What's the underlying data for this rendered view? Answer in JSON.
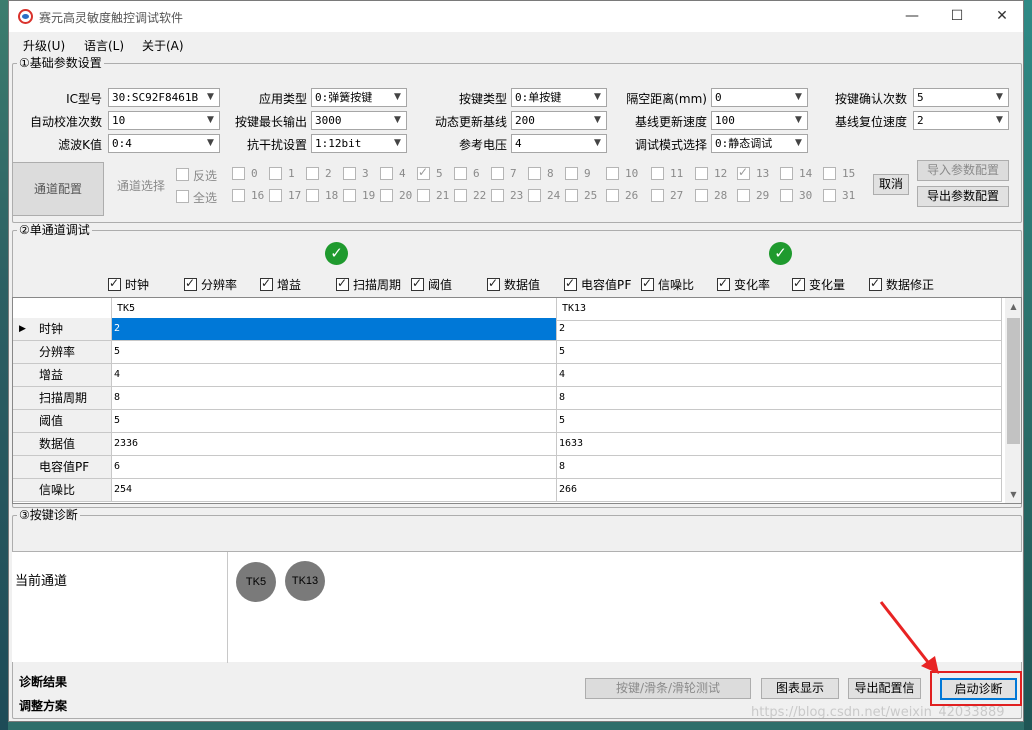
{
  "window": {
    "title": "赛元高灵敏度触控调试软件",
    "controls": {
      "minimize": "—",
      "maximize": "☐",
      "close": "✕"
    }
  },
  "menu": [
    "升级(U)",
    "语言(L)",
    "关于(A)"
  ],
  "basic_params": {
    "title": "①基础参数设置",
    "rows": [
      [
        {
          "label": "IC型号",
          "value": "30:SC92F8461B"
        },
        {
          "label": "应用类型",
          "value": "0:弹簧按键"
        },
        {
          "label": "按键类型",
          "value": "0:单按键"
        },
        {
          "label": "隔空距离(mm)",
          "value": "0"
        },
        {
          "label": "按键确认次数",
          "value": "5"
        }
      ],
      [
        {
          "label": "自动校准次数",
          "value": "10"
        },
        {
          "label": "按键最长输出",
          "value": "3000"
        },
        {
          "label": "动态更新基线",
          "value": "200"
        },
        {
          "label": "基线更新速度",
          "value": "100"
        },
        {
          "label": "基线复位速度",
          "value": "2"
        }
      ],
      [
        {
          "label": "滤波K值",
          "value": "0:4"
        },
        {
          "label": "抗干扰设置",
          "value": "1:12bit"
        },
        {
          "label": "参考电压",
          "value": "4"
        },
        {
          "label": "调试模式选择",
          "value": "0:静态调试"
        }
      ]
    ],
    "channel_config_button": "通道配置",
    "channel_select_label": "通道选择",
    "invert_label": "反选",
    "select_all_label": "全选",
    "channels_row1": [
      "0",
      "1",
      "2",
      "3",
      "4",
      "5",
      "6",
      "7",
      "8",
      "9",
      "10",
      "11",
      "12",
      "13",
      "14",
      "15"
    ],
    "channels_row2": [
      "16",
      "17",
      "18",
      "19",
      "20",
      "21",
      "22",
      "23",
      "24",
      "25",
      "26",
      "27",
      "28",
      "29",
      "30",
      "31"
    ],
    "checked_channels": [
      "5",
      "13"
    ],
    "cancel_button": "取消",
    "import_button": "导入参数配置",
    "export_button": "导出参数配置"
  },
  "single_channel": {
    "title": "②单通道调试",
    "checkboxes": [
      "时钟",
      "分辨率",
      "增益",
      "扫描周期",
      "阈值",
      "数据值",
      "电容值PF",
      "信噪比",
      "变化率",
      "变化量",
      "数据修正"
    ],
    "columns": [
      "TK5",
      "TK13"
    ],
    "rows": [
      {
        "name": "时钟",
        "values": [
          "2",
          "2"
        ]
      },
      {
        "name": "分辨率",
        "values": [
          "5",
          "5"
        ]
      },
      {
        "name": "增益",
        "values": [
          "4",
          "4"
        ]
      },
      {
        "name": "扫描周期",
        "values": [
          "8",
          "8"
        ]
      },
      {
        "name": "阈值",
        "values": [
          "5",
          "5"
        ]
      },
      {
        "name": "数据值",
        "values": [
          "2336",
          "1633"
        ]
      },
      {
        "name": "电容值PF",
        "values": [
          "6",
          "8"
        ]
      },
      {
        "name": "信噪比",
        "values": [
          "254",
          "266"
        ]
      }
    ]
  },
  "diagnosis": {
    "title": "③按键诊断",
    "current_channel_label": "当前通道",
    "channels": [
      "TK5",
      "TK13"
    ],
    "result_label": "诊断结果",
    "adjust_label": "调整方案",
    "buttons": {
      "key_slider_wheel": "按键/滑条/滑轮测试",
      "chart": "图表显示",
      "export_config": "导出配置信",
      "start": "启动诊断"
    }
  },
  "watermark": "https://blog.csdn.net/weixin_42033889",
  "colors": {
    "selection": "#0078d7",
    "status_ok": "#1f9a2e",
    "annotation": "#e02020"
  }
}
